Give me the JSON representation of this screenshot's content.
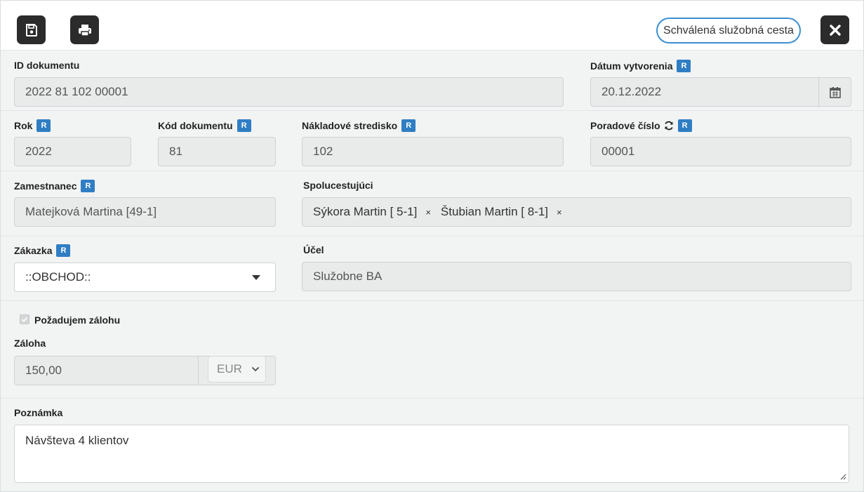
{
  "toolbar": {
    "save_icon": "floppy-disk-icon",
    "print_icon": "printer-icon",
    "close_icon": "close-icon",
    "status": "Schválená služobná cesta"
  },
  "badge": "R",
  "fields": {
    "id_dokumentu": {
      "label": "ID dokumentu",
      "value": "2022 81 102 00001"
    },
    "datum_vytvorenia": {
      "label": "Dátum vytvorenia",
      "value": "20.12.2022",
      "icon": "calendar-icon"
    },
    "rok": {
      "label": "Rok",
      "value": "2022"
    },
    "kod_dokumentu": {
      "label": "Kód dokumentu",
      "value": "81"
    },
    "nakladove_stredisko": {
      "label": "Nákladové stredisko",
      "value": "102"
    },
    "poradove_cislo": {
      "label": "Poradové číslo",
      "value": "00001",
      "icon": "refresh-icon"
    },
    "zamestnanec": {
      "label": "Zamestnanec",
      "value": "Matejková Martina [49-1]"
    },
    "spolucestujuci": {
      "label": "Spolucestujúci",
      "tags": [
        "Sýkora Martin [ 5-1]",
        "Štubian Martin [ 8-1]"
      ],
      "remove_glyph": "×"
    },
    "zakazka": {
      "label": "Zákazka",
      "value": "::OBCHOD::"
    },
    "ucel": {
      "label": "Účel",
      "value": "Služobne BA"
    },
    "pozadujem_zalohu": {
      "label": "Požadujem zálohu",
      "checked": true
    },
    "zaloha": {
      "label": "Záloha",
      "value": "150,00",
      "currency": "EUR"
    },
    "poznamka": {
      "label": "Poznámka",
      "value": "Návšteva 4 klientov"
    }
  },
  "colors": {
    "accent": "#2f7ec4",
    "status_border": "#3d8fd1",
    "dark_button": "#2b2b2b"
  }
}
